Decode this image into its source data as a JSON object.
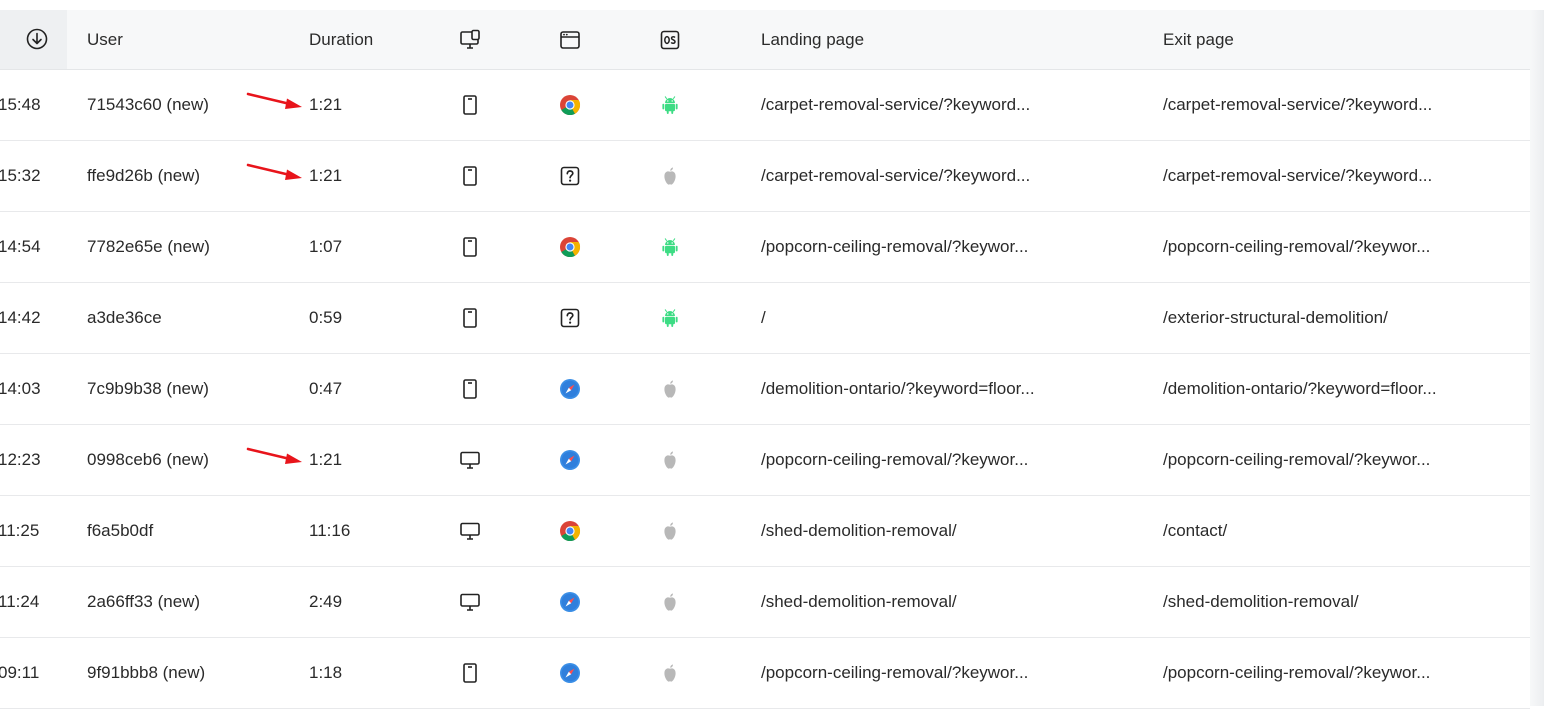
{
  "header": {
    "user": "User",
    "duration": "Duration",
    "landing": "Landing page",
    "exit": "Exit page"
  },
  "rows": [
    {
      "time": "15:48",
      "user": "71543c60 (new)",
      "duration": "1:21",
      "device": "tablet",
      "browser": "chrome",
      "os": "android",
      "landing": "/carpet-removal-service/?keyword...",
      "exit": "/carpet-removal-service/?keyword...",
      "arrow": true
    },
    {
      "time": "15:32",
      "user": "ffe9d26b (new)",
      "duration": "1:21",
      "device": "tablet",
      "browser": "unknown",
      "os": "apple",
      "landing": "/carpet-removal-service/?keyword...",
      "exit": "/carpet-removal-service/?keyword...",
      "arrow": true
    },
    {
      "time": "14:54",
      "user": "7782e65e (new)",
      "duration": "1:07",
      "device": "tablet",
      "browser": "chrome",
      "os": "android",
      "landing": "/popcorn-ceiling-removal/?keywor...",
      "exit": "/popcorn-ceiling-removal/?keywor...",
      "arrow": false
    },
    {
      "time": "14:42",
      "user": "a3de36ce",
      "duration": "0:59",
      "device": "tablet",
      "browser": "unknown",
      "os": "android",
      "landing": "/",
      "exit": "/exterior-structural-demolition/",
      "arrow": false
    },
    {
      "time": "14:03",
      "user": "7c9b9b38 (new)",
      "duration": "0:47",
      "device": "tablet",
      "browser": "safari",
      "os": "apple",
      "landing": "/demolition-ontario/?keyword=floor...",
      "exit": "/demolition-ontario/?keyword=floor...",
      "arrow": false
    },
    {
      "time": "12:23",
      "user": "0998ceb6 (new)",
      "duration": "1:21",
      "device": "desktop",
      "browser": "safari",
      "os": "apple",
      "landing": "/popcorn-ceiling-removal/?keywor...",
      "exit": "/popcorn-ceiling-removal/?keywor...",
      "arrow": true
    },
    {
      "time": "11:25",
      "user": "f6a5b0df",
      "duration": "11:16",
      "device": "desktop",
      "browser": "chrome",
      "os": "apple",
      "landing": "/shed-demolition-removal/",
      "exit": "/contact/",
      "arrow": false
    },
    {
      "time": "11:24",
      "user": "2a66ff33 (new)",
      "duration": "2:49",
      "device": "desktop",
      "browser": "safari",
      "os": "apple",
      "landing": "/shed-demolition-removal/",
      "exit": "/shed-demolition-removal/",
      "arrow": false
    },
    {
      "time": "09:11",
      "user": "9f91bbb8 (new)",
      "duration": "1:18",
      "device": "tablet",
      "browser": "safari",
      "os": "apple",
      "landing": "/popcorn-ceiling-removal/?keywor...",
      "exit": "/popcorn-ceiling-removal/?keywor...",
      "arrow": false
    }
  ],
  "colors": {
    "arrow": "#e8141b",
    "android": "#3ddc84",
    "apple": "#b8b8b8",
    "safari": "#3a8ee6"
  }
}
